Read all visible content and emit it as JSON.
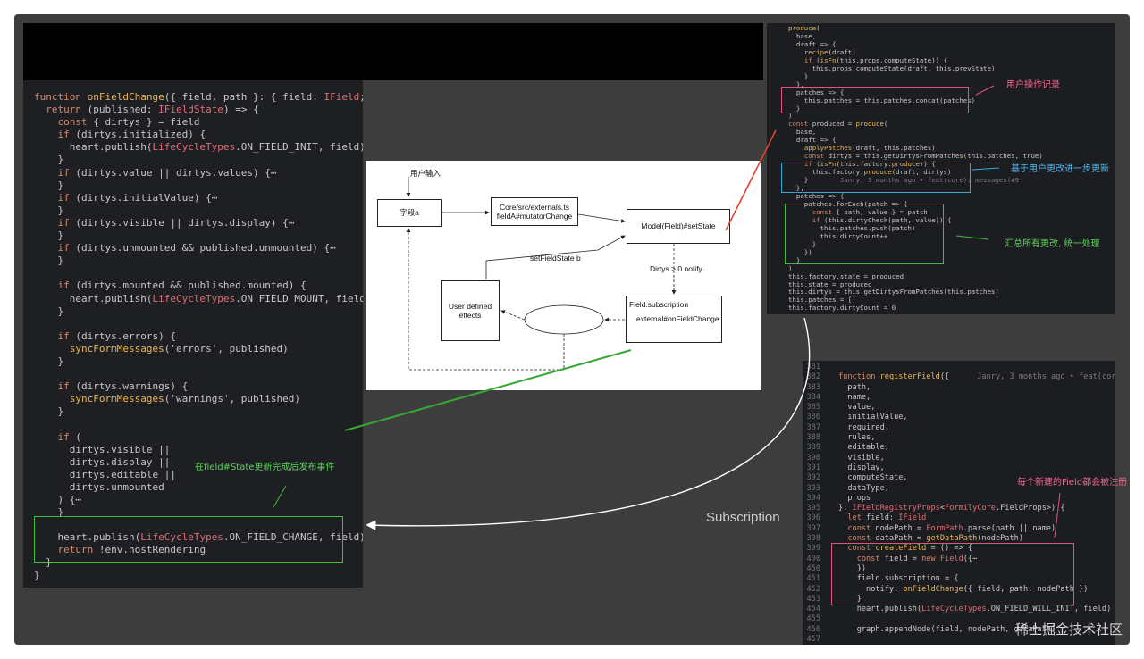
{
  "colors": {
    "frame": "#3d3d3d",
    "editor_bg": "#1e1f22",
    "keyword": "#d78a6a",
    "function": "#e8b75a",
    "type": "#e06c75",
    "highlight_green": "#3fbf3f",
    "highlight_pink": "#e0557a",
    "highlight_blue": "#3aa6e0",
    "arrow_red": "#e0442e",
    "arrow_green": "#35a835"
  },
  "left_code": {
    "lines": [
      "function onFieldChange({ field, path }: { field: IField; path: F",
      "  return (published: IFieldState) => {",
      "    const { dirtys } = field",
      "    if (dirtys.initialized) {",
      "      heart.publish(LifeCycleTypes.ON_FIELD_INIT, field)",
      "    }",
      "    if (dirtys.value || dirtys.values) {⋯",
      "    }",
      "    if (dirtys.initialValue) {⋯",
      "    }",
      "    if (dirtys.visible || dirtys.display) {⋯",
      "    }",
      "    if (dirtys.unmounted && published.unmounted) {⋯",
      "    }",
      "",
      "    if (dirtys.mounted && published.mounted) {",
      "      heart.publish(LifeCycleTypes.ON_FIELD_MOUNT, field)",
      "    }",
      "",
      "    if (dirtys.errors) {",
      "      syncFormMessages('errors', published)",
      "    }",
      "",
      "    if (dirtys.warnings) {",
      "      syncFormMessages('warnings', published)",
      "    }",
      "",
      "    if (",
      "      dirtys.visible ||",
      "      dirtys.display ||",
      "      dirtys.editable ||",
      "      dirtys.unmounted",
      "    ) {⋯",
      "    }",
      "",
      "    heart.publish(LifeCycleTypes.ON_FIELD_CHANGE, field)",
      "    return !env.hostRendering",
      "  }",
      "}"
    ]
  },
  "right_top_code": {
    "lines": [
      "produce(",
      "  base,",
      "  draft => {",
      "    recipe(draft)",
      "    if (isFn(this.props.computeState)) {",
      "      this.props.computeState(draft, this.prevState)",
      "    }",
      "  },",
      "  patches => {",
      "    this.patches = this.patches.concat(patches)",
      "  }",
      ")",
      "const produced = produce(",
      "  base,",
      "  draft => {",
      "    applyPatches(draft, this.patches)",
      "    const dirtys = this.getDirtysFromPatches(this.patches, true)",
      "    if (isFn(this.factory.produce)) {",
      "      this.factory.produce(draft, dirtys)",
      "    }        Janry, 3 months ago • feat(core): messages(#9",
      "  },",
      "  patches => {",
      "    patches.forEach(patch => {",
      "      const { path, value } = patch",
      "      if (this.dirtyCheck(path, value)) {",
      "        this.patches.push(patch)",
      "        this.dirtyCount++",
      "      }",
      "    })",
      "  }",
      ")",
      "this.factory.state = produced",
      "this.state = produced",
      "this.dirtys = this.getDirtysFromPatches(this.patches)",
      "this.patches = []",
      "this.factory.dirtyCount = 0"
    ]
  },
  "right_bottom_code": {
    "gutter": [
      "381",
      "382",
      "383",
      "384",
      "385",
      "386",
      "387",
      "388",
      "389",
      "390",
      "391",
      "392",
      "393",
      "394",
      "395",
      "396",
      "397",
      "398",
      "399",
      "400",
      "450",
      "451",
      "452",
      "453",
      "454",
      "455",
      "456",
      "457"
    ],
    "lines": [
      "",
      "function registerField({      Janry, 3 months ago • feat(core): Bodi",
      "  path,",
      "  name,",
      "  value,",
      "  initialValue,",
      "  required,",
      "  rules,",
      "  editable,",
      "  visible,",
      "  display,",
      "  computeState,",
      "  dataType,",
      "  props",
      "}: IFieldRegistryProps<FormilyCore.FieldProps>) {",
      "  let field: IField",
      "  const nodePath = FormPath.parse(path || name)",
      "  const dataPath = getDataPath(nodePath)",
      "  const createField = () => {",
      "    const field = new Field({⋯",
      "    })",
      "    field.subscription = {",
      "      notify: onFieldChange({ field, path: nodePath })",
      "    }",
      "    heart.publish(LifeCycleTypes.ON_FIELD_WILL_INIT, field)",
      "",
      "    graph.appendNode(field, nodePath, dataPath)",
      ""
    ]
  },
  "annotations": {
    "left_note": "在field#State更新完成后发布事件",
    "user_record": "用户操作记录",
    "further_update": "基于用户更改进一步更新",
    "collect_changes": "汇总所有更改, 统一处理",
    "register_note": "每个新建的Field都会被注册",
    "subscription": "Subscription"
  },
  "diagram": {
    "user_input": "用户输入",
    "field_a": "字段a",
    "externals_line1": "Core/src/externals.ts",
    "externals_line2": "fieldA#mutatorChange",
    "model": "Model(Field)#setState",
    "set_field_state": "setFieldState b",
    "dirtys_notify": "Dirtys > 0 notify",
    "user_effects_line1": "User defined",
    "user_effects_line2": "effects",
    "on_field_change": "onFieldChange, a",
    "subscription_line1": "Field.subscription",
    "subscription_line2": "external#onFieldChange"
  },
  "watermark": "稀土掘金技术社区"
}
